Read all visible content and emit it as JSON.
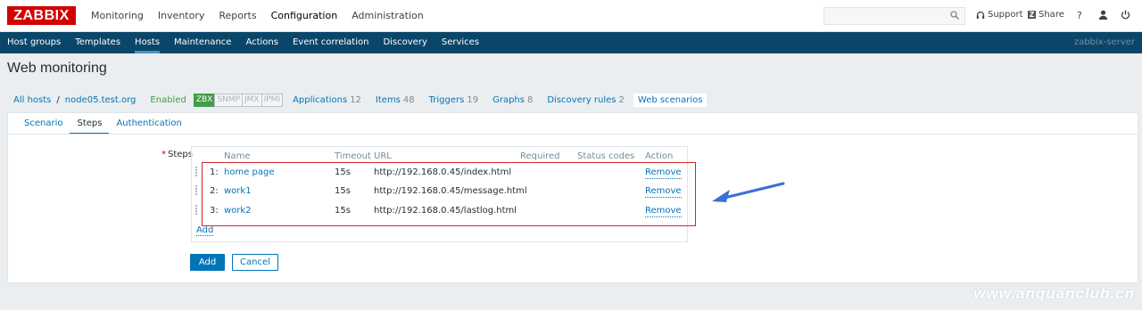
{
  "brand": {
    "logo_text": "ZABBIX"
  },
  "topmenu": {
    "items": [
      {
        "label": "Monitoring"
      },
      {
        "label": "Inventory"
      },
      {
        "label": "Reports"
      },
      {
        "label": "Configuration",
        "active": true
      },
      {
        "label": "Administration"
      }
    ]
  },
  "header_tools": {
    "search_placeholder": "",
    "support_label": "Support",
    "share_label": "Share",
    "help_label": "?",
    "share_badge": "Z"
  },
  "subnav": {
    "items": [
      {
        "label": "Host groups"
      },
      {
        "label": "Templates"
      },
      {
        "label": "Hosts",
        "active": true
      },
      {
        "label": "Maintenance"
      },
      {
        "label": "Actions"
      },
      {
        "label": "Event correlation"
      },
      {
        "label": "Discovery"
      },
      {
        "label": "Services"
      }
    ],
    "server_name": "zabbix-server"
  },
  "page": {
    "title": "Web monitoring"
  },
  "breadcrumb": {
    "all_hosts": "All hosts",
    "separator": "/",
    "host": "node05.test.org",
    "status": "Enabled",
    "availability": [
      "ZBX",
      "SNMP",
      "JMX",
      "IPMI"
    ],
    "links": [
      {
        "label": "Applications",
        "count": "12"
      },
      {
        "label": "Items",
        "count": "48"
      },
      {
        "label": "Triggers",
        "count": "19"
      },
      {
        "label": "Graphs",
        "count": "8"
      },
      {
        "label": "Discovery rules",
        "count": "2"
      }
    ],
    "current": "Web scenarios"
  },
  "tabs": [
    {
      "label": "Scenario"
    },
    {
      "label": "Steps",
      "active": true
    },
    {
      "label": "Authentication"
    }
  ],
  "form": {
    "steps_label": "Steps",
    "required_mark": "*",
    "columns": {
      "name": "Name",
      "timeout": "Timeout",
      "url": "URL",
      "required": "Required",
      "status_codes": "Status codes",
      "action": "Action"
    },
    "steps": [
      {
        "index": "1:",
        "name": "home page",
        "timeout": "15s",
        "url": "http://192.168.0.45/index.html",
        "action": "Remove"
      },
      {
        "index": "2:",
        "name": "work1",
        "timeout": "15s",
        "url": "http://192.168.0.45/message.html",
        "action": "Remove"
      },
      {
        "index": "3:",
        "name": "work2",
        "timeout": "15s",
        "url": "http://192.168.0.45/lastlog.html",
        "action": "Remove"
      }
    ],
    "add_link": "Add",
    "add_button": "Add",
    "cancel_button": "Cancel"
  },
  "watermark": "www.anquanclub.cn",
  "colors": {
    "brand_red": "#d40000",
    "subnav_bg": "#0a466a",
    "link_blue": "#0275b8",
    "enabled_green": "#429e47",
    "highlight_red": "#d9262c",
    "arrow_blue": "#3b6fd6"
  }
}
